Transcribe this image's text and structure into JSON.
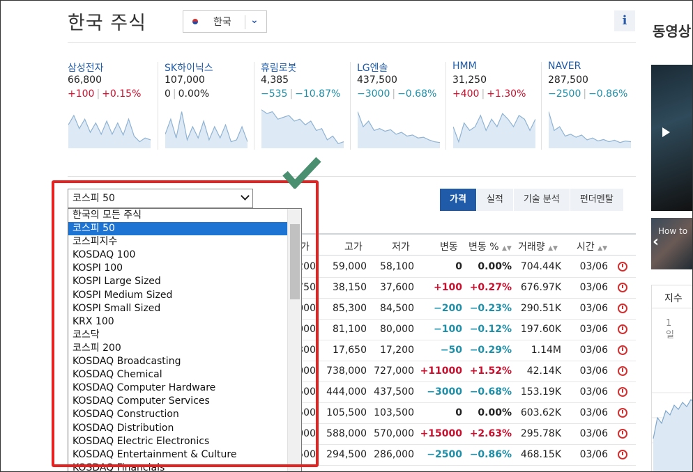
{
  "page": {
    "title": "한국 주식"
  },
  "country_select": {
    "value": "한국"
  },
  "info_button": {
    "label": "i"
  },
  "tickers": [
    {
      "name": "삼성전자",
      "price": "66,800",
      "change": "+100",
      "change_pct": "+0.15%",
      "dir": "up",
      "spark": [
        0.45,
        0.2,
        0.55,
        0.3,
        0.65,
        0.4,
        0.7,
        0.35,
        0.7,
        0.4,
        0.72,
        0.3,
        0.75,
        0.9,
        0.8,
        0.85
      ]
    },
    {
      "name": "SK하이닉스",
      "price": "107,000",
      "change": "0",
      "change_pct": "0.00%",
      "dir": "zero",
      "spark": [
        0.7,
        0.3,
        0.8,
        0.1,
        0.85,
        0.5,
        0.8,
        0.35,
        0.85,
        0.5,
        0.8,
        0.45,
        0.9,
        0.85,
        0.5,
        0.9
      ]
    },
    {
      "name": "휴림로봇",
      "price": "4,385",
      "change": "−535",
      "change_pct": "−10.87%",
      "dir": "dn",
      "spark": [
        0.05,
        0.15,
        0.1,
        0.3,
        0.25,
        0.2,
        0.35,
        0.3,
        0.45,
        0.35,
        0.6,
        0.55,
        0.85,
        0.75,
        0.95,
        0.9
      ]
    },
    {
      "name": "LG엔솔",
      "price": "437,500",
      "change": "−3000",
      "change_pct": "−0.68%",
      "dir": "dn",
      "spark": [
        0.1,
        0.5,
        0.35,
        0.6,
        0.55,
        0.62,
        0.58,
        0.7,
        0.65,
        0.75,
        0.72,
        0.8,
        0.78,
        0.85,
        0.9,
        0.92
      ]
    },
    {
      "name": "HMM",
      "price": "31,250",
      "change": "+400",
      "change_pct": "+1.30%",
      "dir": "up",
      "spark": [
        0.5,
        0.9,
        0.4,
        0.6,
        0.5,
        0.2,
        0.6,
        0.3,
        0.5,
        0.15,
        0.3,
        0.5,
        0.2,
        0.3,
        0.6,
        0.3
      ]
    },
    {
      "name": "NAVER",
      "price": "287,500",
      "change": "−2500",
      "change_pct": "−0.86%",
      "dir": "dn",
      "spark": [
        0.1,
        0.6,
        0.5,
        0.75,
        0.7,
        0.78,
        0.72,
        0.85,
        0.8,
        0.88,
        0.84,
        0.9,
        0.86,
        0.92,
        0.88,
        0.9
      ]
    }
  ],
  "index_select": {
    "value": "코스피 50"
  },
  "dropdown": {
    "selected_index": 1,
    "options": [
      "한국의 모든 주식",
      "코스피 50",
      "코스피지수",
      "KOSDAQ 100",
      "KOSPI 100",
      "KOSPI Large Sized",
      "KOSPI Medium Sized",
      "KOSPI Small Sized",
      "KRX 100",
      "코스닥",
      "코스피 200",
      "KOSDAQ Broadcasting",
      "KOSDAQ Chemical",
      "KOSDAQ Computer Hardware",
      "KOSDAQ Computer Services",
      "KOSDAQ Construction",
      "KOSDAQ Distribution",
      "KOSDAQ Electric Electronics",
      "KOSDAQ Entertainment & Culture",
      "KOSDAQ Financials"
    ]
  },
  "tabs": [
    "가격",
    "실적",
    "기술 분석",
    "펀더멘탈"
  ],
  "table": {
    "headers": [
      "가",
      "고가",
      "저가",
      "변동",
      "변동 %",
      "거래량",
      "시간"
    ],
    "rows": [
      {
        "c0": "200",
        "high": "59,000",
        "low": "58,100",
        "chg": "0",
        "pct": "0.00%",
        "vol": "704.44K",
        "time": "03/06",
        "dir": "zero"
      },
      {
        "c0": "750",
        "high": "38,150",
        "low": "37,600",
        "chg": "+100",
        "pct": "+0.27%",
        "vol": "676.97K",
        "time": "03/06",
        "dir": "up"
      },
      {
        "c0": "000",
        "high": "85,300",
        "low": "84,500",
        "chg": "−200",
        "pct": "−0.23%",
        "vol": "290.51K",
        "time": "03/06",
        "dir": "dn"
      },
      {
        "c0": "000",
        "high": "81,100",
        "low": "80,000",
        "chg": "−100",
        "pct": "−0.12%",
        "vol": "197.60K",
        "time": "03/06",
        "dir": "dn"
      },
      {
        "c0": "300",
        "high": "17,650",
        "low": "17,200",
        "chg": "−50",
        "pct": "−0.29%",
        "vol": "1.14M",
        "time": "03/06",
        "dir": "dn"
      },
      {
        "c0": "000",
        "high": "738,000",
        "low": "727,000",
        "chg": "+11000",
        "pct": "+1.52%",
        "vol": "42.14K",
        "time": "03/06",
        "dir": "up"
      },
      {
        "c0": "500",
        "high": "444,000",
        "low": "437,500",
        "chg": "−3000",
        "pct": "−0.68%",
        "vol": "153.19K",
        "time": "03/06",
        "dir": "dn"
      },
      {
        "c0": "500",
        "high": "105,500",
        "low": "103,500",
        "chg": "0",
        "pct": "0.00%",
        "vol": "603.62K",
        "time": "03/06",
        "dir": "zero"
      },
      {
        "c0": "000",
        "high": "588,000",
        "low": "570,000",
        "chg": "+15000",
        "pct": "+2.63%",
        "vol": "295.78K",
        "time": "03/06",
        "dir": "up"
      },
      {
        "c0": "500",
        "high": "294,500",
        "low": "286,000",
        "chg": "−2500",
        "pct": "−0.86%",
        "vol": "468.15K",
        "time": "03/06",
        "dir": "dn"
      }
    ]
  },
  "right_panel": {
    "title": "동영상",
    "video_title": "How to",
    "index_label": "지수",
    "date_label": "1일"
  },
  "colors": {
    "up": "#c8102e",
    "down": "#1f8fa8",
    "brand": "#1f5ba8",
    "highlight": "#e32222",
    "check": "#4a8f6f"
  }
}
